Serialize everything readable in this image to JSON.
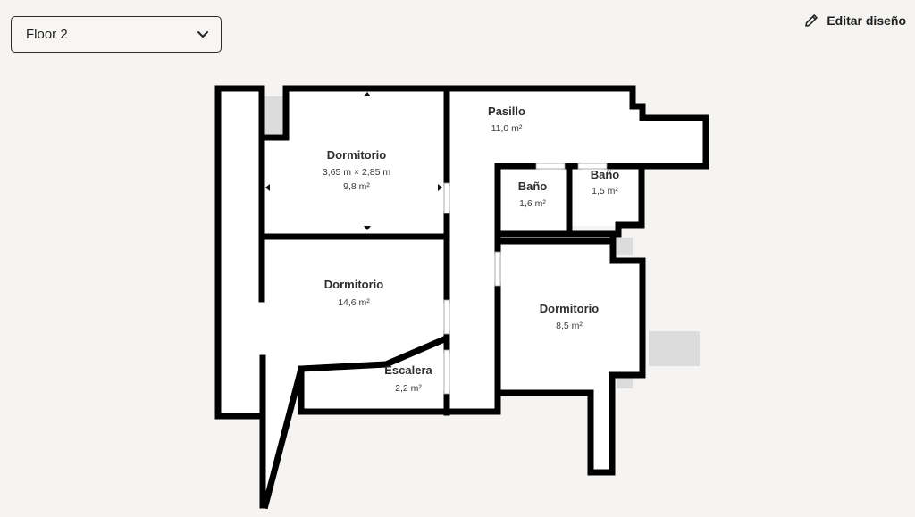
{
  "floor_selector": {
    "value": "Floor 2",
    "icon": "chevron-down-icon"
  },
  "edit_button": {
    "label": "Editar diseño",
    "icon": "pencil-icon"
  },
  "rooms": {
    "dormitorio_top": {
      "name": "Dormitorio",
      "dimensions": "3,65 m × 2,85 m",
      "area": "9,8 m²"
    },
    "dormitorio_mid": {
      "name": "Dormitorio",
      "area": "14,6 m²"
    },
    "escalera": {
      "name": "Escalera",
      "area": "2,2 m²"
    },
    "pasillo": {
      "name": "Pasillo",
      "area": "11,0 m²"
    },
    "bano_left": {
      "name": "Baño",
      "area": "1,6 m²"
    },
    "bano_right": {
      "name": "Baño",
      "area": "1,5 m²"
    },
    "dormitorio_right": {
      "name": "Dormitorio",
      "area": "8,5 m²"
    }
  },
  "colors": {
    "background": "#f5f4f2",
    "wall": "#000000",
    "room_fill": "#ffffff",
    "outdoor_fill": "#dcdcdc"
  }
}
